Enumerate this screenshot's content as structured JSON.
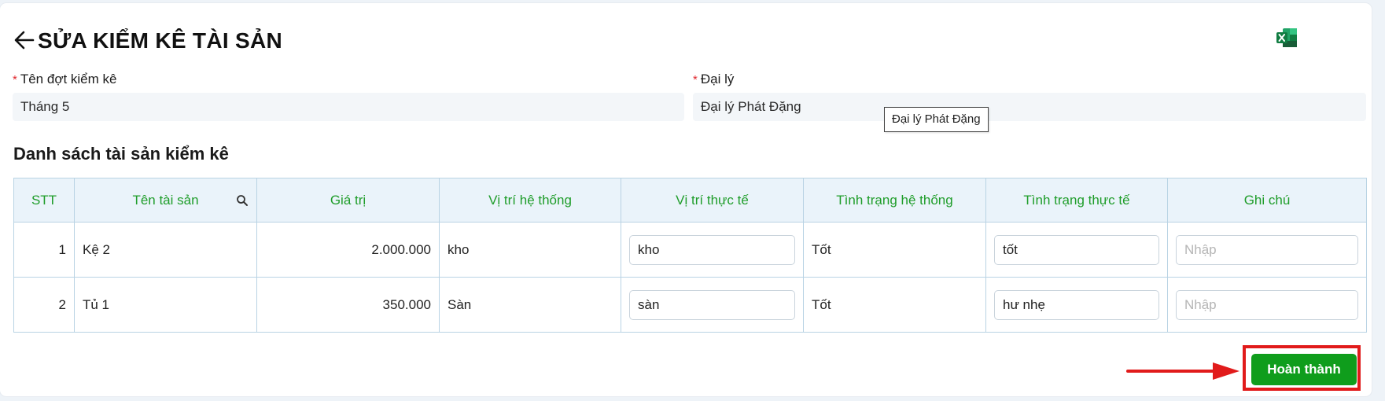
{
  "header": {
    "title": "SỬA KIỂM KÊ TÀI SẢN",
    "back_icon": "arrow-left-icon",
    "export_icon": "excel-icon"
  },
  "form": {
    "batch_label": "Tên đợt kiểm kê",
    "batch_value": "Tháng 5",
    "agency_label": "Đại lý",
    "agency_value": "Đại lý Phát Đặng",
    "agency_tooltip": "Đại lý Phát Đặng",
    "required_mark": "*"
  },
  "section": {
    "title": "Danh sách tài sản kiểm kê"
  },
  "table": {
    "headers": [
      "STT",
      "Tên tài sản",
      "Giá trị",
      "Vị trí hệ thống",
      "Vị trí thực tế",
      "Tình trạng hệ thống",
      "Tình trạng thực tế",
      "Ghi chú"
    ],
    "placeholder_note": "Nhập",
    "rows": [
      {
        "stt": "1",
        "name": "Kệ 2",
        "value": "2.000.000",
        "sys_location": "kho",
        "actual_location": "kho",
        "sys_status": "Tốt",
        "actual_status": "tốt",
        "note": ""
      },
      {
        "stt": "2",
        "name": "Tủ 1",
        "value": "350.000",
        "sys_location": "Sàn",
        "actual_location": "sàn",
        "sys_status": "Tốt",
        "actual_status": "hư nhẹ",
        "note": ""
      }
    ]
  },
  "actions": {
    "done_label": "Hoàn thành"
  },
  "colors": {
    "accent_green": "#0f9d1c",
    "header_text_green": "#1f9d2a",
    "highlight_red": "#e11b1b"
  }
}
